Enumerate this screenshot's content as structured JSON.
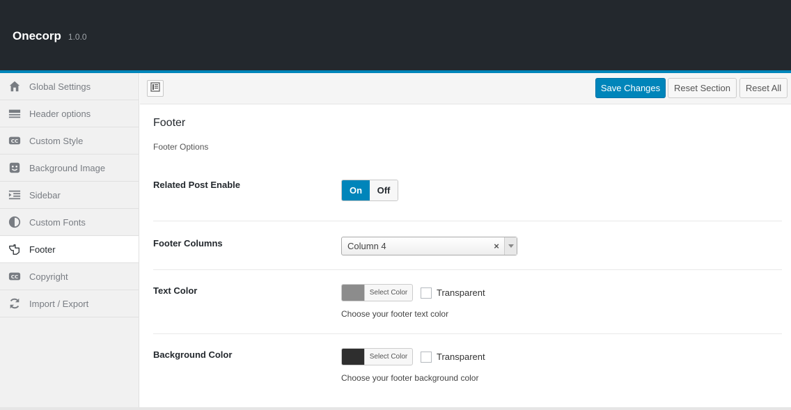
{
  "header": {
    "title": "Onecorp",
    "version": "1.0.0"
  },
  "sidebar": {
    "items": [
      {
        "label": "Global Settings",
        "icon": "home-icon"
      },
      {
        "label": "Header options",
        "icon": "header-icon"
      },
      {
        "label": "Custom Style",
        "icon": "cc-icon"
      },
      {
        "label": "Background Image",
        "icon": "smiley-icon"
      },
      {
        "label": "Sidebar",
        "icon": "sidebar-icon"
      },
      {
        "label": "Custom Fonts",
        "icon": "contrast-icon"
      },
      {
        "label": "Footer",
        "icon": "hand-pointer-icon",
        "active": true
      },
      {
        "label": "Copyright",
        "icon": "cc-icon"
      },
      {
        "label": "Import / Export",
        "icon": "refresh-icon"
      }
    ]
  },
  "toolbar": {
    "save_label": "Save Changes",
    "reset_section_label": "Reset Section",
    "reset_all_label": "Reset All"
  },
  "section": {
    "title": "Footer",
    "description": "Footer Options",
    "fields": {
      "related_post": {
        "label": "Related Post Enable",
        "on_label": "On",
        "off_label": "Off",
        "value": "On"
      },
      "footer_columns": {
        "label": "Footer Columns",
        "value": "Column 4"
      },
      "text_color": {
        "label": "Text Color",
        "button_label": "Select Color",
        "transparent_label": "Transparent",
        "help": "Choose your footer text color",
        "color": "#8c8c8c"
      },
      "bg_color": {
        "label": "Background Color",
        "button_label": "Select Color",
        "transparent_label": "Transparent",
        "help": "Choose your footer background color",
        "color": "#2e2e2e"
      }
    }
  },
  "colors": {
    "accent": "#0085ba",
    "topbar": "#23282d"
  }
}
